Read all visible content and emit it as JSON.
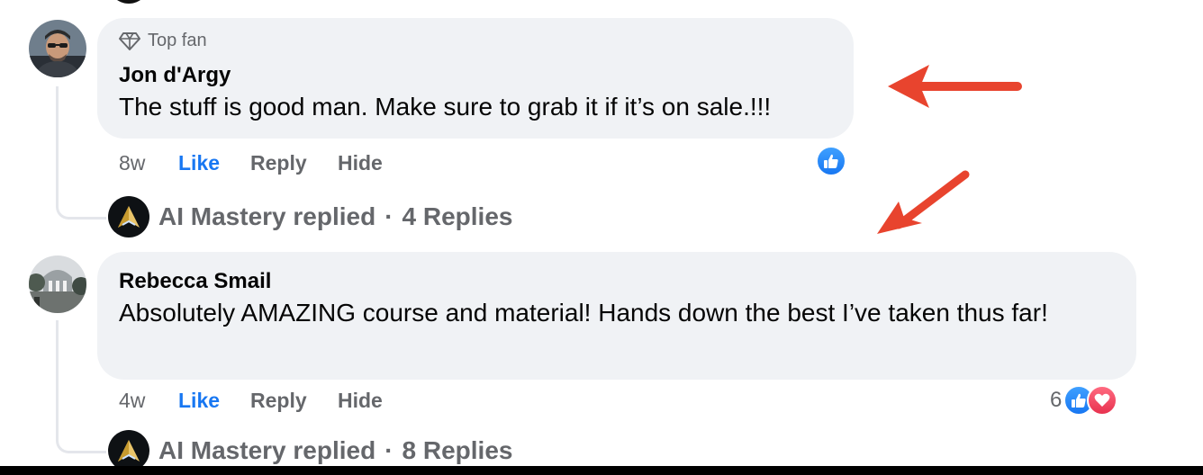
{
  "comments": [
    {
      "badge": "Top fan",
      "author": "Jon d'Argy",
      "text": "The stuff is good man. Make sure to grab it if it’s on sale.!!!",
      "time": "8w",
      "like_label": "Like",
      "reply_label": "Reply",
      "hide_label": "Hide",
      "reactions": [
        "like"
      ],
      "reaction_count": "",
      "replied_by": "AI Mastery replied",
      "separator": "·",
      "replies": "4 Replies"
    },
    {
      "author": "Rebecca Smail",
      "text": "Absolutely AMAZING course and material! Hands down the best I’ve taken thus far!",
      "time": "4w",
      "like_label": "Like",
      "reply_label": "Reply",
      "hide_label": "Hide",
      "reactions": [
        "like",
        "love"
      ],
      "reaction_count": "6",
      "replied_by": "AI Mastery replied",
      "separator": "·",
      "replies": "8 Replies"
    }
  ],
  "colors": {
    "bubble": "#f0f2f5",
    "like_blue": "#1877f2",
    "meta_gray": "#65676b",
    "annotation_arrow": "#e8442e"
  },
  "icons": {
    "badge": "diamond-icon",
    "like_reaction": "thumbs-up-icon",
    "love_reaction": "heart-icon",
    "page_logo": "ai-mastery-logo",
    "annotation": "red-arrow-icon"
  }
}
